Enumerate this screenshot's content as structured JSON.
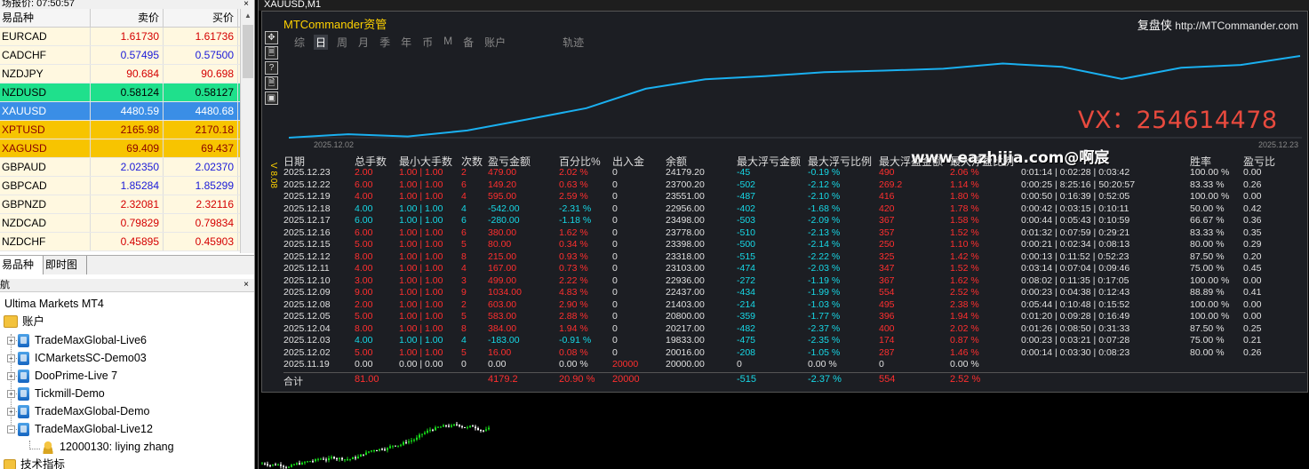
{
  "market_watch": {
    "title": "场报价: 07:50:57",
    "close": "×",
    "headers": {
      "symbol": "易品种",
      "bid": "卖价",
      "ask": "买价"
    },
    "rows": [
      {
        "symbol": "EURCAD",
        "bid": "1.61730",
        "ask": "1.61736",
        "dir": "up",
        "hl": ""
      },
      {
        "symbol": "CADCHF",
        "bid": "0.57495",
        "ask": "0.57500",
        "dir": "down",
        "hl": ""
      },
      {
        "symbol": "NZDJPY",
        "bid": "90.684",
        "ask": "90.698",
        "dir": "up",
        "hl": ""
      },
      {
        "symbol": "NZDUSD",
        "bid": "0.58124",
        "ask": "0.58127",
        "dir": "up",
        "hl": "green"
      },
      {
        "symbol": "XAUUSD",
        "bid": "4480.59",
        "ask": "4480.68",
        "dir": "up",
        "hl": "blue"
      },
      {
        "symbol": "XPTUSD",
        "bid": "2165.98",
        "ask": "2170.18",
        "dir": "up",
        "hl": "orange"
      },
      {
        "symbol": "XAGUSD",
        "bid": "69.409",
        "ask": "69.437",
        "dir": "up",
        "hl": "orange"
      },
      {
        "symbol": "GBPAUD",
        "bid": "2.02350",
        "ask": "2.02370",
        "dir": "down",
        "hl": ""
      },
      {
        "symbol": "GBPCAD",
        "bid": "1.85284",
        "ask": "1.85299",
        "dir": "down",
        "hl": ""
      },
      {
        "symbol": "GBPNZD",
        "bid": "2.32081",
        "ask": "2.32116",
        "dir": "up",
        "hl": ""
      },
      {
        "symbol": "NZDCAD",
        "bid": "0.79829",
        "ask": "0.79834",
        "dir": "up",
        "hl": ""
      },
      {
        "symbol": "NZDCHF",
        "bid": "0.45895",
        "ask": "0.45903",
        "dir": "up",
        "hl": ""
      }
    ],
    "tabs": [
      "易品种",
      "即时图"
    ]
  },
  "navigator": {
    "title": "航",
    "close": "×",
    "root": "Ultima Markets MT4",
    "accounts_label": "账户",
    "accounts": [
      "TradeMaxGlobal-Live6",
      "ICMarketsSC-Demo03",
      "DooPrime-Live 7",
      "Tickmill-Demo",
      "TradeMaxGlobal-Demo",
      "TradeMaxGlobal-Live12"
    ],
    "sub_account": "12000130: liying zhang",
    "indicators_label": "技术指标",
    "expand_glyph": "+",
    "collapse_glyph": "−"
  },
  "chart": {
    "window_title": "XAUUSD,M1",
    "panel_name": "MTCommander资管",
    "brand": "复盘侠",
    "brand_url": "http://MTCommander.com",
    "tools": [
      "✥",
      "🗏",
      "?",
      "🗎",
      "▣"
    ],
    "tabs": [
      "综",
      "日",
      "周",
      "月",
      "季",
      "年",
      "币",
      "M",
      "备",
      "账户",
      "轨迹"
    ],
    "active_tab": 1,
    "equity_start": "2025.12.02",
    "equity_end": "2025.12.23",
    "equity_curve": [
      19833,
      20016,
      19900,
      20217,
      20800,
      21403,
      22437,
      22936,
      23103,
      23318,
      23398,
      23498,
      23778,
      23600,
      22956,
      23551,
      23700,
      24179
    ],
    "watermark": "VX：254614478",
    "site_watermark": "www.eazhijia.com@啊宸",
    "version": "V 8.08",
    "columns": [
      "日期",
      "总手数",
      "最小大手数",
      "次数",
      "盈亏金额",
      "百分比%",
      "出入金",
      "余额",
      "最大浮亏金额",
      "最大浮亏比例",
      "最大浮盈金额",
      "最大浮盈比例",
      "",
      "胜率",
      "盈亏比"
    ],
    "rows": [
      [
        "2025.12.23",
        "2.00",
        "1.00 | 1.00",
        "2",
        "479.00",
        "2.02 %",
        "0",
        "24179.20",
        "-45",
        "-0.19 %",
        "490",
        "2.06 %",
        "0:01:14 | 0:02:28 | 0:03:42",
        "100.00 %",
        "0.00"
      ],
      [
        "2025.12.22",
        "6.00",
        "1.00 | 1.00",
        "6",
        "149.20",
        "0.63 %",
        "0",
        "23700.20",
        "-502",
        "-2.12 %",
        "269.2",
        "1.14 %",
        "0:00:25 | 8:25:16 | 50:20:57",
        "83.33 %",
        "0.26"
      ],
      [
        "2025.12.19",
        "4.00",
        "1.00 | 1.00",
        "4",
        "595.00",
        "2.59 %",
        "0",
        "23551.00",
        "-487",
        "-2.10 %",
        "416",
        "1.80 %",
        "0:00:50 | 0:16:39 | 0:52:05",
        "100.00 %",
        "0.00"
      ],
      [
        "2025.12.18",
        "4.00",
        "1.00 | 1.00",
        "4",
        "-542.00",
        "-2.31 %",
        "0",
        "22956.00",
        "-402",
        "-1.68 %",
        "420",
        "1.78 %",
        "0:00:42 | 0:03:15 | 0:10:11",
        "50.00 %",
        "0.42"
      ],
      [
        "2025.12.17",
        "6.00",
        "1.00 | 1.00",
        "6",
        "-280.00",
        "-1.18 %",
        "0",
        "23498.00",
        "-503",
        "-2.09 %",
        "367",
        "1.58 %",
        "0:00:44 | 0:05:43 | 0:10:59",
        "66.67 %",
        "0.36"
      ],
      [
        "2025.12.16",
        "6.00",
        "1.00 | 1.00",
        "6",
        "380.00",
        "1.62 %",
        "0",
        "23778.00",
        "-510",
        "-2.13 %",
        "357",
        "1.52 %",
        "0:01:32 | 0:07:59 | 0:29:21",
        "83.33 %",
        "0.35"
      ],
      [
        "2025.12.15",
        "5.00",
        "1.00 | 1.00",
        "5",
        "80.00",
        "0.34 %",
        "0",
        "23398.00",
        "-500",
        "-2.14 %",
        "250",
        "1.10 %",
        "0:00:21 | 0:02:34 | 0:08:13",
        "80.00 %",
        "0.29"
      ],
      [
        "2025.12.12",
        "8.00",
        "1.00 | 1.00",
        "8",
        "215.00",
        "0.93 %",
        "0",
        "23318.00",
        "-515",
        "-2.22 %",
        "325",
        "1.42 %",
        "0:00:13 | 0:11:52 | 0:52:23",
        "87.50 %",
        "0.20"
      ],
      [
        "2025.12.11",
        "4.00",
        "1.00 | 1.00",
        "4",
        "167.00",
        "0.73 %",
        "0",
        "23103.00",
        "-474",
        "-2.03 %",
        "347",
        "1.52 %",
        "0:03:14 | 0:07:04 | 0:09:46",
        "75.00 %",
        "0.45"
      ],
      [
        "2025.12.10",
        "3.00",
        "1.00 | 1.00",
        "3",
        "499.00",
        "2.22 %",
        "0",
        "22936.00",
        "-272",
        "-1.19 %",
        "367",
        "1.62 %",
        "0:08:02 | 0:11:35 | 0:17:05",
        "100.00 %",
        "0.00"
      ],
      [
        "2025.12.09",
        "9.00",
        "1.00 | 1.00",
        "9",
        "1034.00",
        "4.83 %",
        "0",
        "22437.00",
        "-434",
        "-1.99 %",
        "554",
        "2.52 %",
        "0:00:23 | 0:04:38 | 0:12:43",
        "88.89 %",
        "0.41"
      ],
      [
        "2025.12.08",
        "2.00",
        "1.00 | 1.00",
        "2",
        "603.00",
        "2.90 %",
        "0",
        "21403.00",
        "-214",
        "-1.03 %",
        "495",
        "2.38 %",
        "0:05:44 | 0:10:48 | 0:15:52",
        "100.00 %",
        "0.00"
      ],
      [
        "2025.12.05",
        "5.00",
        "1.00 | 1.00",
        "5",
        "583.00",
        "2.88 %",
        "0",
        "20800.00",
        "-359",
        "-1.77 %",
        "396",
        "1.94 %",
        "0:01:20 | 0:09:28 | 0:16:49",
        "100.00 %",
        "0.00"
      ],
      [
        "2025.12.04",
        "8.00",
        "1.00 | 1.00",
        "8",
        "384.00",
        "1.94 %",
        "0",
        "20217.00",
        "-482",
        "-2.37 %",
        "400",
        "2.02 %",
        "0:01:26 | 0:08:50 | 0:31:33",
        "87.50 %",
        "0.25"
      ],
      [
        "2025.12.03",
        "4.00",
        "1.00 | 1.00",
        "4",
        "-183.00",
        "-0.91 %",
        "0",
        "19833.00",
        "-475",
        "-2.35 %",
        "174",
        "0.87 %",
        "0:00:23 | 0:03:21 | 0:07:28",
        "75.00 %",
        "0.21"
      ],
      [
        "2025.12.02",
        "5.00",
        "1.00 | 1.00",
        "5",
        "16.00",
        "0.08 %",
        "0",
        "20016.00",
        "-208",
        "-1.05 %",
        "287",
        "1.46 %",
        "0:00:14 | 0:03:30 | 0:08:23",
        "80.00 %",
        "0.26"
      ],
      [
        "2025.11.19",
        "0.00",
        "0.00 | 0.00",
        "0",
        "0.00",
        "0.00 %",
        "20000",
        "20000.00",
        "0",
        "0.00 %",
        "0",
        "0.00 %",
        "",
        "",
        ""
      ]
    ],
    "totals": {
      "label": "合计",
      "lots": "81.00",
      "pnl": "4179.2",
      "pct": "20.90 %",
      "deposit": "20000",
      "max_dd": "-515",
      "max_dd_pct": "-2.37 %",
      "max_fp": "554",
      "max_fp_pct": "2.52 %"
    }
  }
}
